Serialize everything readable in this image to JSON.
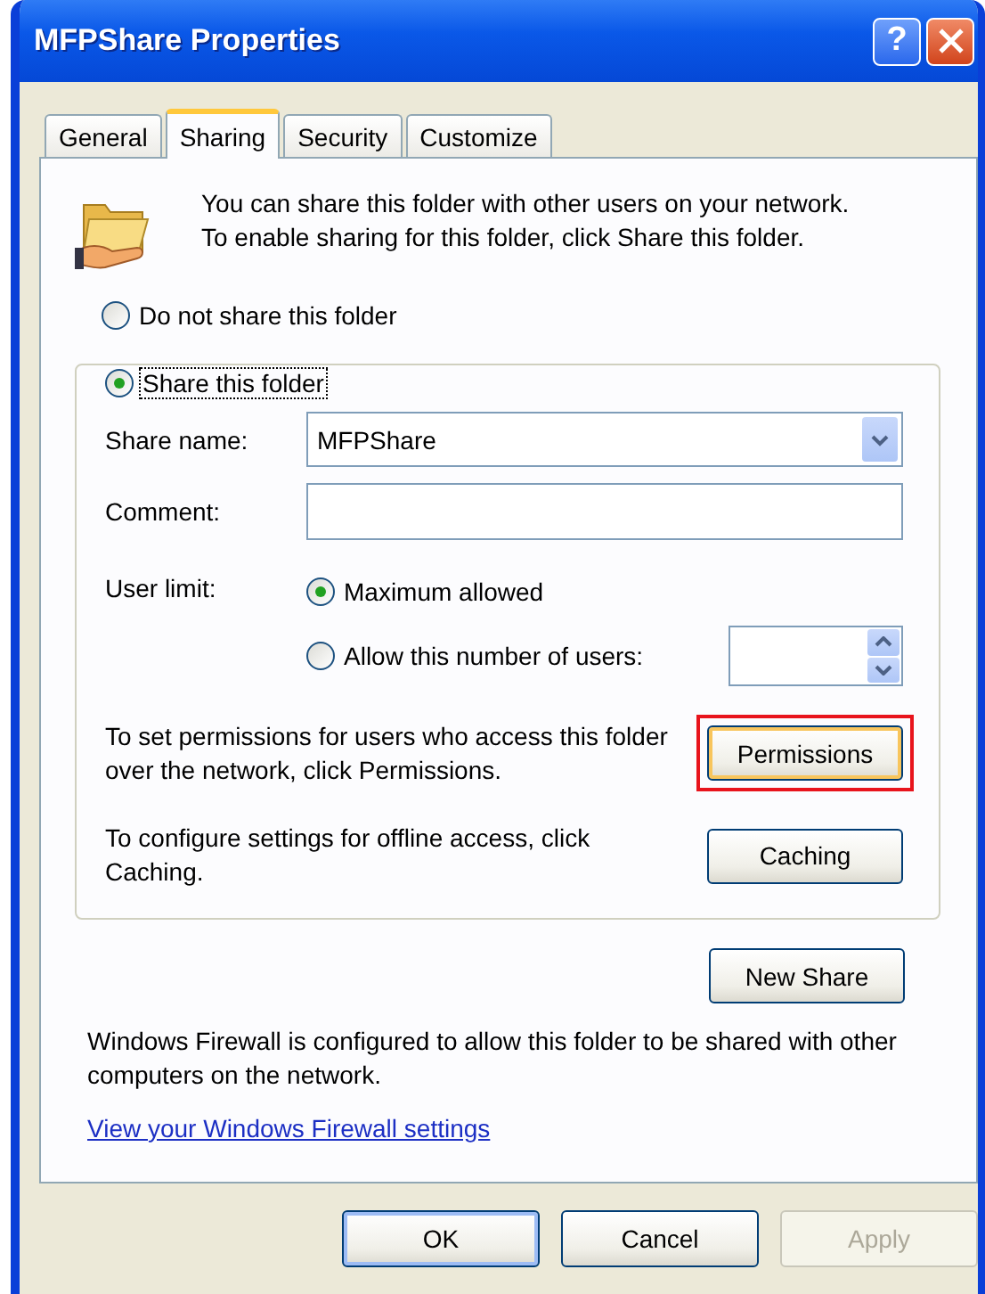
{
  "window": {
    "title": "MFPShare Properties"
  },
  "title_buttons": [
    {
      "kind": "help",
      "label": "?"
    },
    {
      "kind": "close"
    }
  ],
  "tabs": [
    {
      "label": "General",
      "selected": false
    },
    {
      "label": "Sharing",
      "selected": true
    },
    {
      "label": "Security",
      "selected": false
    },
    {
      "label": "Customize",
      "selected": false
    }
  ],
  "intro": "You can share this folder with other users on your network.  To enable sharing for this folder, click Share this folder.",
  "share_options": [
    {
      "label": "Do not share this folder",
      "selected": false
    },
    {
      "label": "Share this folder",
      "selected": true
    }
  ],
  "share_name": {
    "label": "Share name:",
    "value": "MFPShare"
  },
  "comment": {
    "label": "Comment:"
  },
  "user_limit": {
    "label": "User limit:",
    "options": [
      {
        "label": "Maximum allowed",
        "selected": true
      },
      {
        "label": "Allow this number of users:",
        "selected": false
      }
    ]
  },
  "permissions": {
    "text": "To set permissions for users who access this folder over the network, click Permissions.",
    "button": "Permissions",
    "highlighted": true
  },
  "caching": {
    "text": "To configure settings for offline access, click Caching.",
    "button": "Caching"
  },
  "new_share_button": "New Share",
  "firewall": {
    "text": "Windows Firewall is configured to allow this folder to be shared with other computers on the network.",
    "link": "View your Windows Firewall settings"
  },
  "buttons": [
    {
      "label": "OK",
      "default": true,
      "disabled": false
    },
    {
      "label": "Cancel",
      "default": false,
      "disabled": false
    },
    {
      "label": "Apply",
      "default": false,
      "disabled": true
    }
  ]
}
